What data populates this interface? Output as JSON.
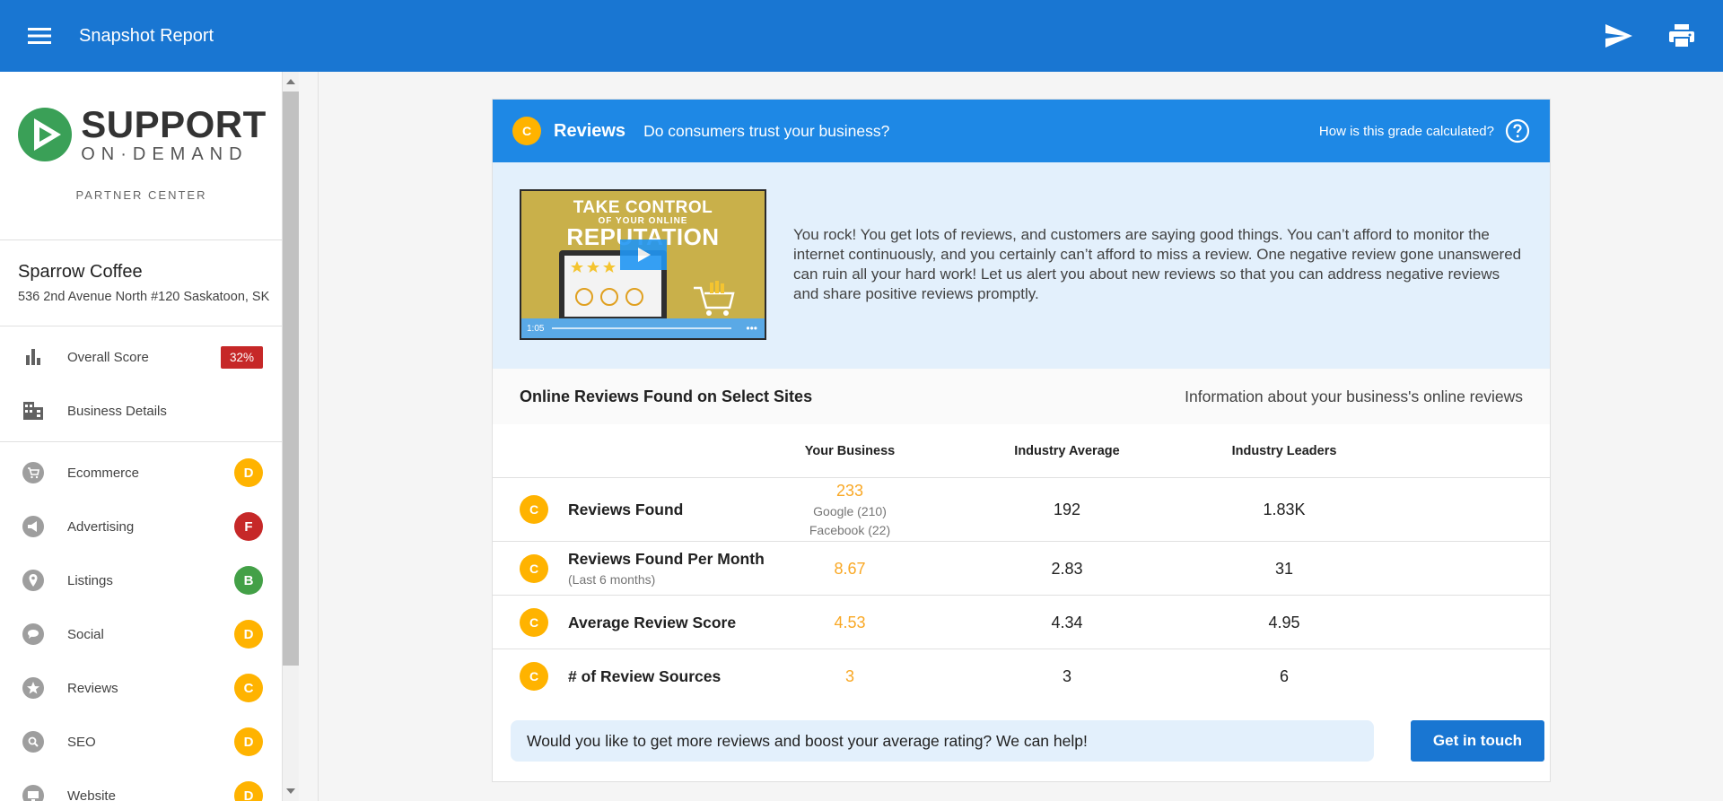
{
  "topbar": {
    "title": "Snapshot Report",
    "icons": [
      "menu-icon",
      "send-icon",
      "print-icon"
    ]
  },
  "sidebar": {
    "logo": {
      "line1": "SUPPORT",
      "line2": "ON·DEMAND",
      "tagline": "PARTNER CENTER"
    },
    "business": {
      "name": "Sparrow Coffee",
      "address": "536 2nd Avenue North #120 Saskatoon, SK"
    },
    "top_items": [
      {
        "label": "Overall Score",
        "icon": "bar-chart-icon",
        "score": "32%"
      },
      {
        "label": "Business Details",
        "icon": "building-icon"
      }
    ],
    "items": [
      {
        "label": "Ecommerce",
        "icon": "cart-icon",
        "grade": "D"
      },
      {
        "label": "Advertising",
        "icon": "megaphone-icon",
        "grade": "F"
      },
      {
        "label": "Listings",
        "icon": "location-pin-icon",
        "grade": "B"
      },
      {
        "label": "Social",
        "icon": "chat-icon",
        "grade": "D"
      },
      {
        "label": "Reviews",
        "icon": "star-icon",
        "grade": "C"
      },
      {
        "label": "SEO",
        "icon": "search-icon",
        "grade": "D"
      },
      {
        "label": "Website",
        "icon": "monitor-icon",
        "grade": "D"
      }
    ]
  },
  "section": {
    "grade": "C",
    "title": "Reviews",
    "question": "Do consumers trust your business?",
    "help_link": "How is this grade calculated?",
    "video": {
      "title_line1": "TAKE CONTROL",
      "title_line2": "OF YOUR ONLINE",
      "title_line3": "REPUTATION",
      "duration": "1:05"
    },
    "intro_text": "You rock! You get lots of reviews, and customers are saying good things. You can’t afford to monitor the internet continuously, and you certainly can’t afford to miss a review. One negative review gone unanswered can ruin all your hard work! Let us alert you about new reviews so that you can address negative reviews and share positive reviews promptly.",
    "subheader": {
      "title": "Online Reviews Found on Select Sites",
      "info": "Information about your business's online reviews"
    },
    "table": {
      "columns": [
        "Your Business",
        "Industry Average",
        "Industry Leaders"
      ],
      "rows": [
        {
          "grade": "C",
          "label": "Reviews Found",
          "sub": "",
          "yours": "233",
          "yours_detail": [
            "Google (210)",
            "Facebook (22)"
          ],
          "average": "192",
          "leaders": "1.83K"
        },
        {
          "grade": "C",
          "label": "Reviews Found Per Month",
          "sub": "(Last 6 months)",
          "yours": "8.67",
          "average": "2.83",
          "leaders": "31"
        },
        {
          "grade": "C",
          "label": "Average Review Score",
          "sub": "",
          "yours": "4.53",
          "average": "4.34",
          "leaders": "4.95"
        },
        {
          "grade": "C",
          "label": "# of Review Sources",
          "sub": "",
          "yours": "3",
          "average": "3",
          "leaders": "6"
        }
      ]
    },
    "cta": {
      "text": "Would you like to get more reviews and boost your average rating? We can help!",
      "button": "Get in touch"
    }
  },
  "colors": {
    "topbar": "#1976d2",
    "section_header": "#1e88e5",
    "grade_c": "#ffb300",
    "grade_f": "#c62828",
    "grade_b": "#43a047",
    "intro_bg": "#e3f0fc",
    "yours_value": "#f9a825"
  }
}
